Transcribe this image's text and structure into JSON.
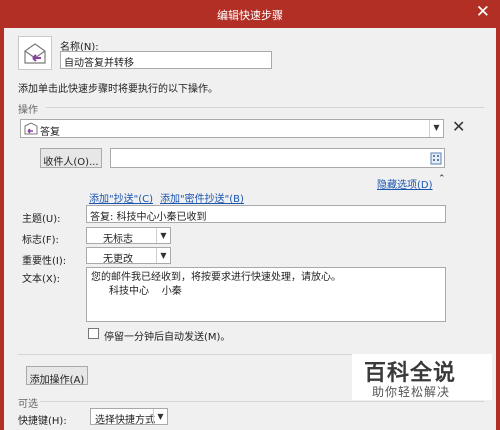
{
  "window": {
    "title": "编辑快速步骤",
    "close_icon": "close-icon"
  },
  "name": {
    "label": "名称(N):",
    "value": "自动答复并转移"
  },
  "intro_text": "添加单击此快速步骤时将要执行的以下操作。",
  "operations_group_label": "操作",
  "action": {
    "selected": "答复",
    "icon": "reply-mail-icon",
    "remove_icon": "remove-x-icon"
  },
  "recipients": {
    "button_label": "收件人(O)...",
    "value": "",
    "address_book_icon": "address-book-icon"
  },
  "options_link": "隐藏选项(D)",
  "add_cc_link": "添加\"抄送\"(C)",
  "add_bcc_link": "添加\"密件抄送\"(B)",
  "subject": {
    "label": "主题(U):",
    "value": "答复: 科技中心小秦已收到"
  },
  "flag": {
    "label": "标志(F):",
    "value": "无标志"
  },
  "importance": {
    "label": "重要性(I):",
    "value": "无更改"
  },
  "body": {
    "label": "文本(X):",
    "line1": "您的邮件我已经收到，将按要求进行快速处理，请放心。",
    "line2": "科技中心    小秦"
  },
  "delay_send": {
    "label": "停留一分钟后自动发送(M)。",
    "checked": false
  },
  "add_action_button": "添加操作(A)",
  "optional_group_label": "可选",
  "shortcut": {
    "label": "快捷键(H):",
    "value": "选择快捷方式"
  },
  "watermark": {
    "title": "百科全说",
    "subtitle": "助你轻松解决"
  }
}
